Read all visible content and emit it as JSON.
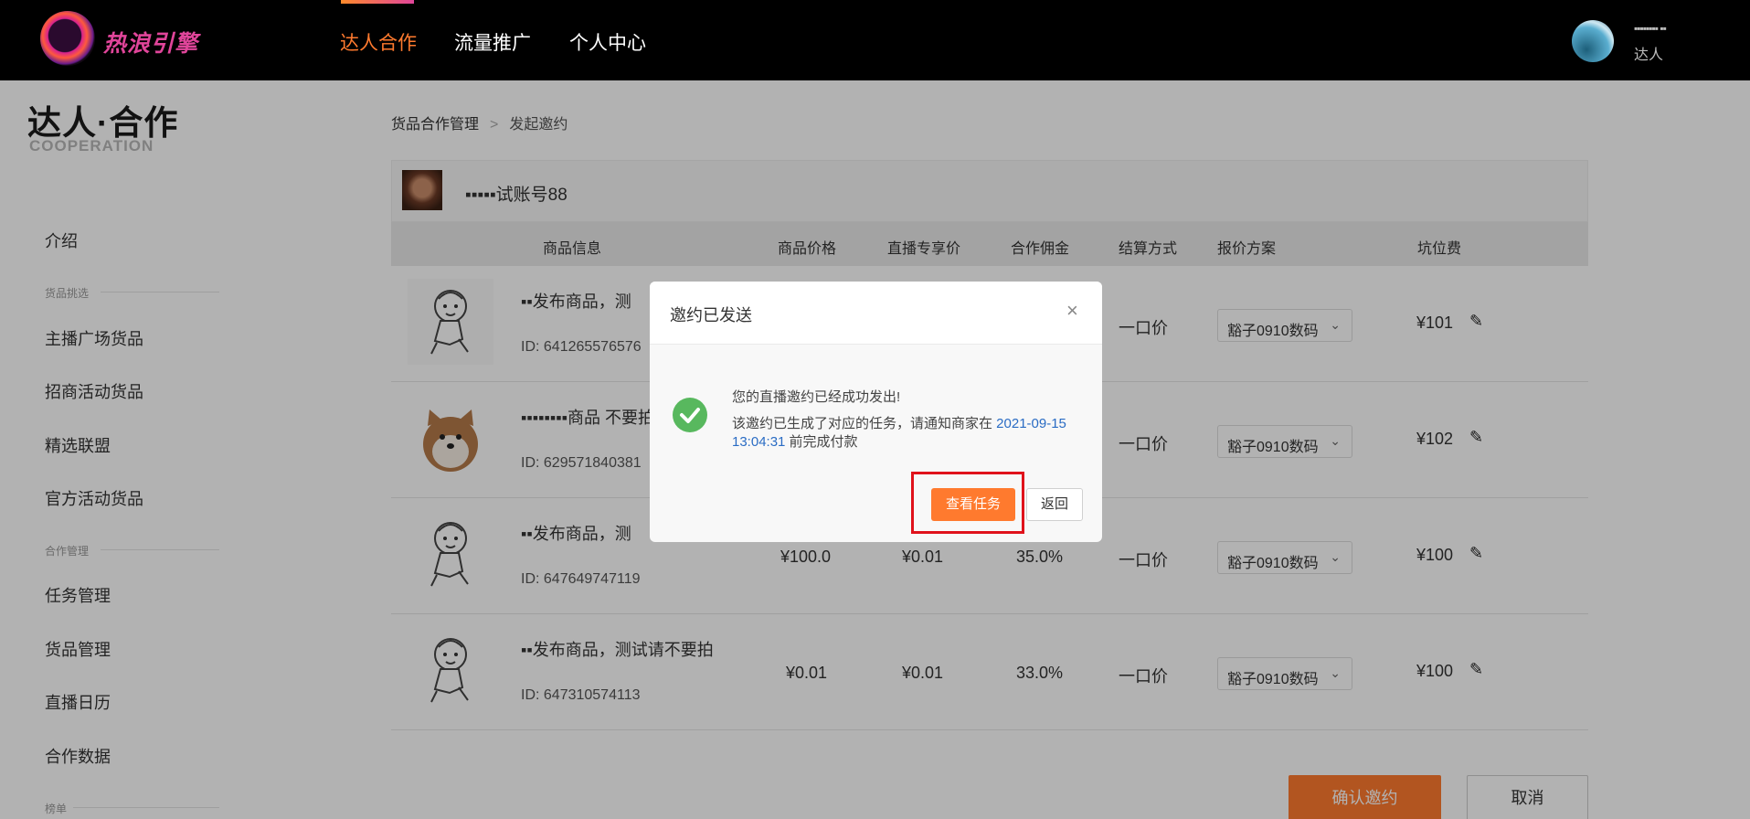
{
  "header": {
    "logo_text": "热浪引擎",
    "nav": [
      {
        "label": "达人合作",
        "active": true
      },
      {
        "label": "流量推广",
        "active": false
      },
      {
        "label": "个人中心",
        "active": false
      }
    ],
    "user": {
      "name": "▪▪▪▪▪▪▪▪ ▪▪",
      "role": "达人"
    }
  },
  "sidebar": {
    "brand_title": "达人·合作",
    "brand_sub": "COOPERATION",
    "intro": "介绍",
    "group_selection": "货品挑选",
    "selection_items": [
      "主播广场货品",
      "招商活动货品",
      "精选联盟",
      "官方活动货品"
    ],
    "group_cooperation": "合作管理",
    "cooperation_items": [
      "任务管理",
      "货品管理",
      "直播日历",
      "合作数据"
    ],
    "group_rank": "榜单"
  },
  "breadcrumb": {
    "parent": "货品合作管理",
    "sep": ">",
    "current": "发起邀约"
  },
  "account": {
    "name": "▪▪▪▪▪试账号88"
  },
  "table": {
    "headers": [
      "商品信息",
      "商品价格",
      "直播专享价",
      "合作佣金",
      "结算方式",
      "报价方案",
      "坑位费"
    ],
    "rows": [
      {
        "title": "▪▪发布商品，测",
        "id": "ID: 641265576576",
        "price": "",
        "live_price": "",
        "commission": "",
        "settle": "一口价",
        "plan": "豁子0910数码",
        "fee": "¥101",
        "thumb": "cartoon"
      },
      {
        "title": "▪▪▪▪▪▪▪▪商品 不要拍",
        "id": "ID: 629571840381",
        "price": "",
        "live_price": "",
        "commission": "",
        "settle": "一口价",
        "plan": "豁子0910数码",
        "fee": "¥102",
        "thumb": "dog"
      },
      {
        "title": "▪▪发布商品，测",
        "id": "ID: 647649747119",
        "price": "¥100.0",
        "live_price": "¥0.01",
        "commission": "35.0%",
        "settle": "一口价",
        "plan": "豁子0910数码",
        "fee": "¥100",
        "thumb": "cartoon"
      },
      {
        "title": "▪▪发布商品，测试请不要拍",
        "id": "ID: 647310574113",
        "price": "¥0.01",
        "live_price": "¥0.01",
        "commission": "33.0%",
        "settle": "一口价",
        "plan": "豁子0910数码",
        "fee": "¥100",
        "thumb": "cartoon"
      }
    ]
  },
  "actions": {
    "confirm": "确认邀约",
    "cancel": "取消"
  },
  "modal": {
    "title": "邀约已发送",
    "close": "×",
    "line1": "您的直播邀约已经成功发出!",
    "line2_pre": "该邀约已生成了对应的任务，请通知商家在 ",
    "line2_date": "2021-09-15 13:04:31",
    "line2_post": " 前完成付款",
    "view_task": "查看任务",
    "back": "返回"
  },
  "colors": {
    "accent": "#ff7a2e",
    "highlight": "#e0121b",
    "success": "#58b85e",
    "link": "#2a6cc4"
  }
}
